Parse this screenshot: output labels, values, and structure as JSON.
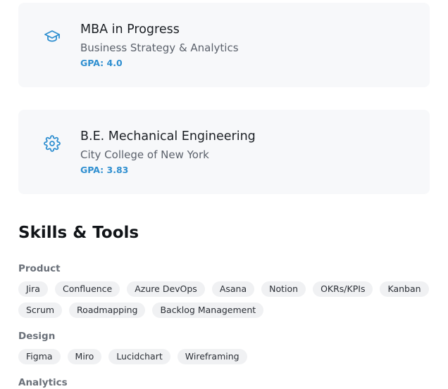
{
  "education": [
    {
      "icon": "graduation-cap-icon",
      "title": "MBA in Progress",
      "subtitle": "Business Strategy & Analytics",
      "gpa": "GPA: 4.0"
    },
    {
      "icon": "gear-icon",
      "title": "B.E. Mechanical Engineering",
      "subtitle": "City College of New York",
      "gpa": "GPA: 3.83"
    }
  ],
  "skills": {
    "title": "Skills & Tools",
    "groups": {
      "product": {
        "label": "Product",
        "row1": [
          "Jira",
          "Confluence",
          "Azure DevOps",
          "Asana",
          "Notion",
          "OKRs/KPIs",
          "Kanban"
        ],
        "row2": [
          "Scrum",
          "Roadmapping",
          "Backlog Management"
        ]
      },
      "design": {
        "label": "Design",
        "row1": [
          "Figma",
          "Miro",
          "Lucidchart",
          "Wireframing"
        ]
      },
      "analytics": {
        "label": "Analytics"
      }
    }
  },
  "colors": {
    "accent": "#2f8fd0",
    "card_bg": "#f7f8fa",
    "chip_bg": "#f0f1f3"
  }
}
